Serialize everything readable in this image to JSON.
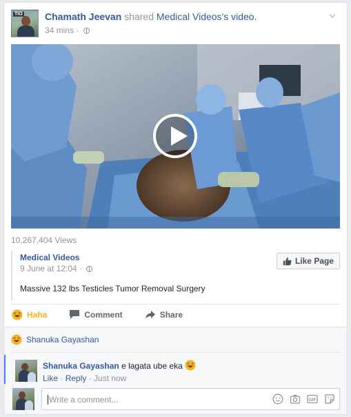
{
  "post": {
    "author": "Chamath Jeevan",
    "shared_word": "shared",
    "source_page": "Medical Videos",
    "source_suffix": "'s video.",
    "time": "34 mins",
    "avatar_tag": "TIO"
  },
  "video": {
    "views": "10,267,404 Views"
  },
  "shared": {
    "page_name": "Medical Videos",
    "time": "9 June at 12:04",
    "like_page_label": "Like Page",
    "description": "Massive 132 lbs Testicles Tumor Removal Surgery"
  },
  "actions": {
    "haha": "Haha",
    "comment": "Comment",
    "share": "Share"
  },
  "reactions": {
    "name": "Shanuka Gayashan"
  },
  "comment": {
    "author": "Shanuka Gayashan",
    "text": "e lagata ube eka",
    "like": "Like",
    "reply": "Reply",
    "time": "Just now",
    "separator": " · "
  },
  "composer": {
    "placeholder": "Write a comment..."
  },
  "colors": {
    "link": "#365899",
    "haha": "#f7b125",
    "comment_accent": "#4080ff"
  }
}
